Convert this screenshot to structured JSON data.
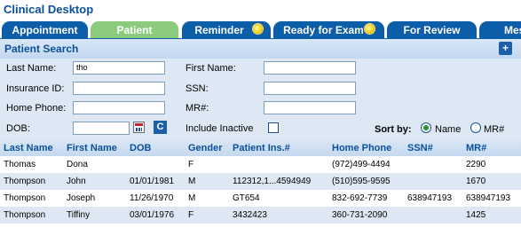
{
  "app": {
    "title": "Clinical Desktop"
  },
  "tabs": [
    {
      "label": "Appointment",
      "active": false,
      "indicator": false
    },
    {
      "label": "Patient",
      "active": true,
      "indicator": false
    },
    {
      "label": "Reminder",
      "active": false,
      "indicator": true
    },
    {
      "label": "Ready for Exam",
      "active": false,
      "indicator": true
    },
    {
      "label": "For Review",
      "active": false,
      "indicator": false
    },
    {
      "label": "Mes",
      "active": false,
      "indicator": false
    }
  ],
  "panel": {
    "title": "Patient Search",
    "add_label": "+"
  },
  "form": {
    "last_name_label": "Last Name:",
    "last_name_value": "tho",
    "first_name_label": "First Name:",
    "first_name_value": "",
    "insurance_id_label": "Insurance ID:",
    "insurance_id_value": "",
    "ssn_label": "SSN:",
    "ssn_value": "",
    "home_phone_label": "Home Phone:",
    "home_phone_value": "",
    "mr_label": "MR#:",
    "mr_value": "",
    "dob_label": "DOB:",
    "dob_value": "",
    "clear_label": "C",
    "include_inactive_label": "Include Inactive",
    "include_inactive_checked": false,
    "sort_by_label": "Sort by:",
    "sort_options": [
      "Name",
      "MR#"
    ],
    "sort_selected": "Name"
  },
  "results": {
    "columns": [
      "Last Name",
      "First Name",
      "DOB",
      "Gender",
      "Patient Ins.#",
      "Home Phone",
      "SSN#",
      "MR#"
    ],
    "rows": [
      [
        "Thomas",
        "Dona",
        "",
        "F",
        "",
        "(972)499-4494",
        "",
        "2290"
      ],
      [
        "Thompson",
        "John",
        "01/01/1981",
        "M",
        "112312,1...4594949",
        "(510)595-9595",
        "",
        "1670"
      ],
      [
        "Thompson",
        "Joseph",
        "11/26/1970",
        "M",
        "GT654",
        "832-692-7739",
        "638947193",
        "638947193"
      ],
      [
        "Thompson",
        "Tiffiny",
        "03/01/1976",
        "F",
        "3432423",
        "360-731-2090",
        "",
        "1425"
      ]
    ]
  },
  "colors": {
    "tab_blue": "#0d5ea8",
    "tab_active_green": "#8ccb7e",
    "header_text_blue": "#0b4f9a",
    "panel_bg": "#dde8f4"
  }
}
